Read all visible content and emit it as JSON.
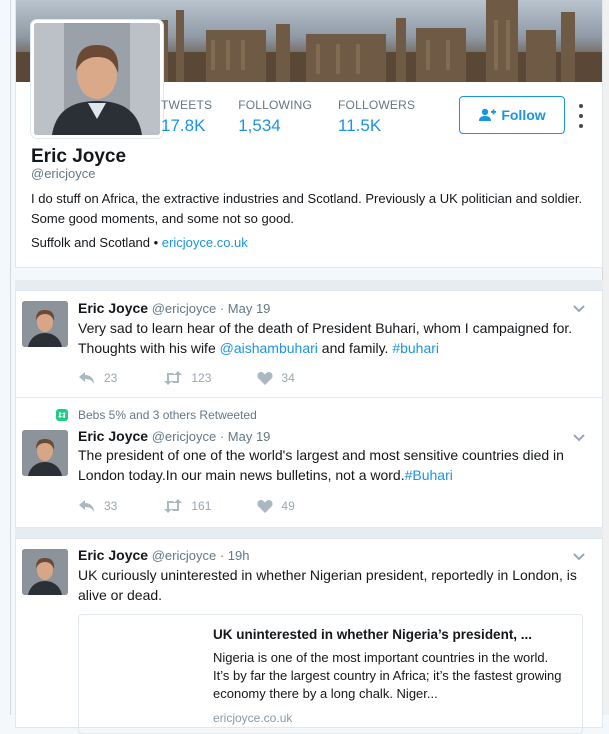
{
  "profile": {
    "name": "Eric Joyce",
    "handle": "@ericjoyce",
    "stats": [
      {
        "label": "TWEETS",
        "value": "17.8K"
      },
      {
        "label": "FOLLOWING",
        "value": "1,534"
      },
      {
        "label": "FOLLOWERS",
        "value": "11.5K"
      }
    ],
    "follow_label": "Follow",
    "bio": "I do stuff on Africa, the extractive industries and Scotland. Previously a UK politician and soldier. Some good moments, and some not so good.",
    "location": "Suffolk and Scotland",
    "separator": " • ",
    "website": "ericjoyce.co.uk"
  },
  "tweets": [
    {
      "name": "Eric Joyce",
      "handle": "@ericjoyce",
      "time": "May 19",
      "text_pre": "Very sad to learn hear of the death of President Buhari, whom I campaigned for. Thoughts with his wife ",
      "mention": "@aishambuhari",
      "text_mid": " and family. ",
      "hashtag": "#buhari",
      "replies": "23",
      "retweets": "123",
      "likes": "34"
    },
    {
      "retweet_note": "Bebs 5% and 3 others Retweeted",
      "name": "Eric Joyce",
      "handle": "@ericjoyce",
      "time": "May 19",
      "text_pre": "The president of one of the world's largest and most sensitive countries died in London today.In our main news bulletins, not a word.",
      "hashtag": "#Buhari",
      "replies": "33",
      "retweets": "161",
      "likes": "49"
    },
    {
      "name": "Eric Joyce",
      "handle": "@ericjoyce",
      "time": "19h",
      "text_pre": "UK curiously uninterested in whether Nigerian president, reportedly in London, is alive or dead.",
      "card": {
        "title": "UK uninterested in whether Nigeria’s president, ...",
        "description": "Nigeria is one of the most important countries in the world. It’s by far the largest country in Africa; it’s the fastest growing economy there by a long chalk. Niger...",
        "domain": "ericjoyce.co.uk"
      }
    }
  ],
  "colors": {
    "accent": "#1b95e0",
    "muted": "#657786",
    "retweet_green": "#19cf86"
  }
}
